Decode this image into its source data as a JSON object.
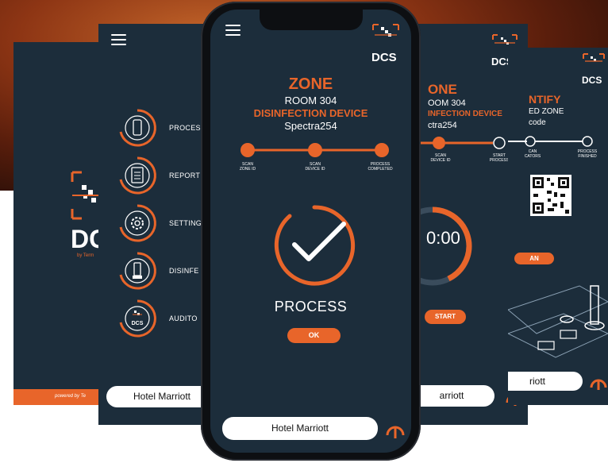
{
  "brand": {
    "logo_text": "DCS",
    "logo_partial": "DC",
    "by_line": "by Term",
    "powered_by": "powered by Te"
  },
  "menu": {
    "items": [
      {
        "label": "PROCES",
        "icon": "phone-scan-icon"
      },
      {
        "label": "REPORT",
        "icon": "clipboard-icon"
      },
      {
        "label": "SETTING",
        "icon": "gear-icon"
      },
      {
        "label": "DISINFE",
        "icon": "sprayer-device-icon"
      },
      {
        "label": "AUDITO",
        "icon": "dcs-logo-icon"
      }
    ],
    "hotel_button": "Hotel Marriott"
  },
  "main": {
    "heading": "ZONE",
    "room": "ROOM 304",
    "device_label": "DISINFECTION DEVICE",
    "device_name": "Spectra254",
    "steps": [
      {
        "label": "SCAN\nZONE ID"
      },
      {
        "label": "SCAN\nDEVICE ID"
      },
      {
        "label": "PROCESS\nCOMPLETED"
      }
    ],
    "status": "PROCESS",
    "ok_button": "OK",
    "hotel_button": "Hotel Marriott"
  },
  "timer_screen": {
    "heading": "ONE",
    "room": "OOM 304",
    "device_label": "INFECTION DEVICE",
    "device_name": "ctra254",
    "steps": [
      {
        "label": "SCAN\nDEVICE ID"
      },
      {
        "label": "START\nPROCESS"
      }
    ],
    "timer": "0:00",
    "start_button": "START",
    "hotel_button": "arriott"
  },
  "identify_screen": {
    "heading": "NTIFY",
    "line1": "ED ZONE",
    "line2": "code",
    "steps": [
      {
        "label": "CAN\nCATORS"
      },
      {
        "label": "PROCESS\nFINISHED"
      }
    ],
    "scan_button": "AN",
    "hotel_button": "riott"
  },
  "colors": {
    "accent": "#e8652a",
    "screen_bg": "#1c2d3b",
    "text": "#ffffff"
  }
}
